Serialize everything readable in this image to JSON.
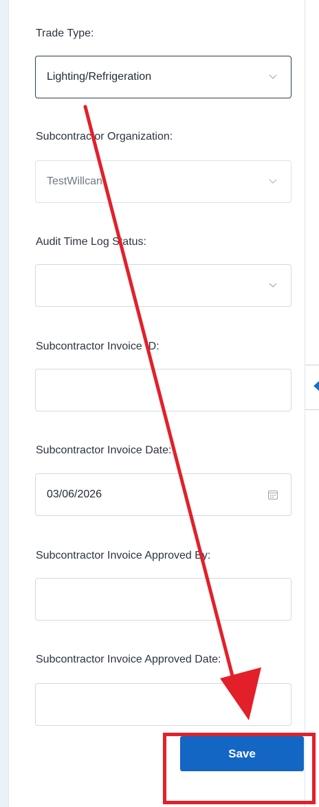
{
  "form": {
    "trade_type": {
      "label": "Trade Type:",
      "value": "Lighting/Refrigeration"
    },
    "subcontractor_org": {
      "label": "Subcontractor Organization:",
      "value": "TestWillcan"
    },
    "audit_status": {
      "label": "Audit Time Log Status:",
      "value": ""
    },
    "invoice_id": {
      "label": "Subcontractor Invoice ID:",
      "value": ""
    },
    "invoice_date": {
      "label": "Subcontractor Invoice Date:",
      "value": "03/06/2026"
    },
    "approved_by": {
      "label": "Subcontractor Invoice Approved By:",
      "value": ""
    },
    "approved_date": {
      "label": "Subcontractor Invoice Approved Date:",
      "value": ""
    }
  },
  "actions": {
    "save_label": "Save"
  },
  "colors": {
    "primary": "#1466c4",
    "annotation": "#e3202a"
  },
  "icons": {
    "dropdown": "chevron-down-icon",
    "calendar": "calendar-icon",
    "collapse": "caret-left-icon"
  }
}
